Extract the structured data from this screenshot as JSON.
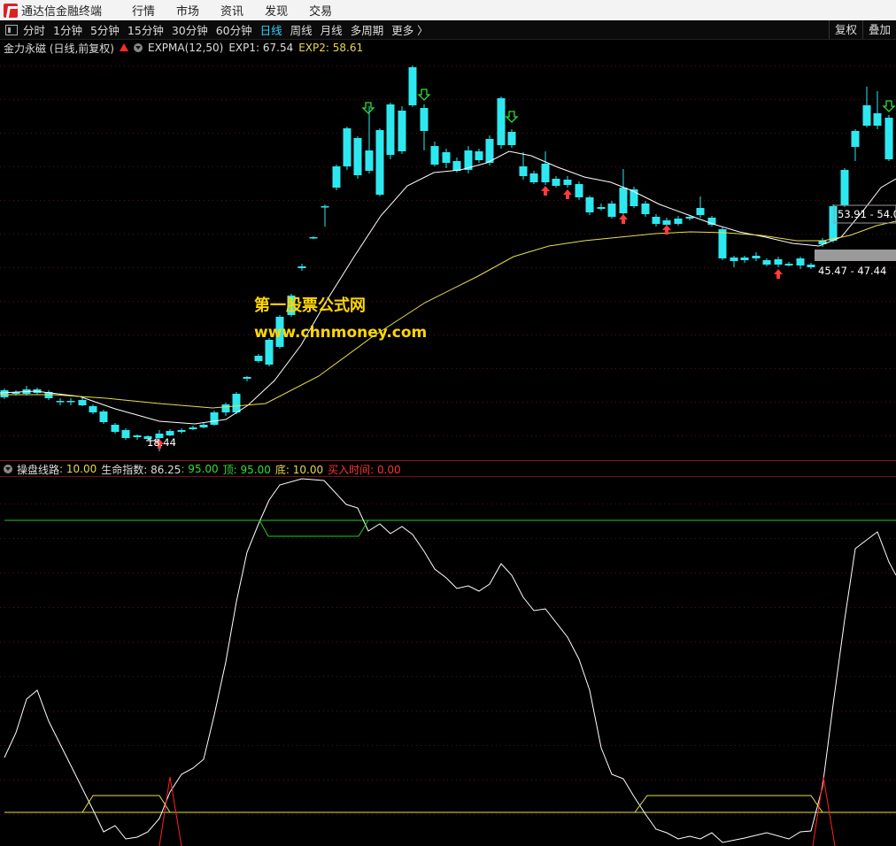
{
  "menubar": {
    "app_name": "通达信金融终端",
    "items": [
      "行情",
      "市场",
      "资讯",
      "发现",
      "交易"
    ]
  },
  "toolbar": {
    "periods": [
      "分时",
      "1分钟",
      "5分钟",
      "15分钟",
      "30分钟",
      "60分钟",
      "日线",
      "周线",
      "月线",
      "多周期",
      "更多 〉"
    ],
    "active_period": "日线",
    "right_buttons": [
      "复权",
      "叠加"
    ]
  },
  "main_chart": {
    "title": "金力永磁 (日线,前复权)",
    "indicator": "EXPMA(12,50)",
    "exp1_label": "EXP1: 67.54",
    "exp2_label": "EXP2: 58.61",
    "low_label": "18.44",
    "box_label_top": "53.91 - 54.0",
    "box_label_bottom": "45.47 - 47.44",
    "colors": {
      "up": "#ff3b3b",
      "down": "#2ee8f0",
      "exp1": "#ffffff",
      "exp2": "#e8e04a",
      "signal_down": "#33dd33"
    }
  },
  "watermark": {
    "line1": "第一股票公式网",
    "line2": "www.chnmoney.com"
  },
  "sub_chart": {
    "name": "操盘线路",
    "value1": ": 10.00",
    "label2": "生命指数: 86.25",
    "label3": ": 95.00",
    "label4": "顶: 95.00",
    "label5": "底: 10.00",
    "label6": "买入时间: 0.00",
    "top_level": 95,
    "bottom_level": 10
  }
}
